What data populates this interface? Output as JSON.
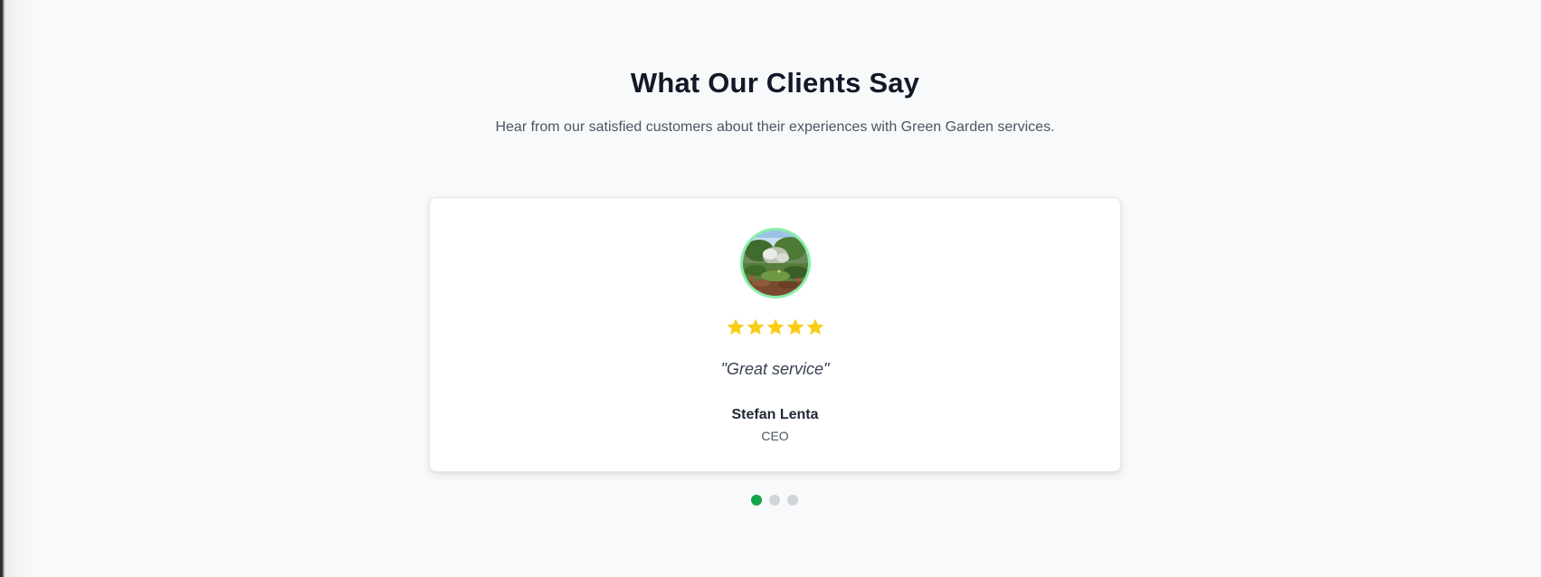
{
  "section": {
    "title": "What Our Clients Say",
    "subtitle": "Hear from our satisfied customers about their experiences with Green Garden services."
  },
  "testimonial": {
    "avatar_icon": "garden-photo",
    "rating": 5,
    "rating_max": 5,
    "quote": "\"Great service\"",
    "name": "Stefan Lenta",
    "role": "CEO"
  },
  "carousel": {
    "total": 3,
    "active_index": 0
  },
  "colors": {
    "accent": "#16a34a",
    "star": "#facc15",
    "avatar_ring": "#86efac",
    "dot_inactive": "#d1d5db",
    "background": "#f8f9fa"
  }
}
